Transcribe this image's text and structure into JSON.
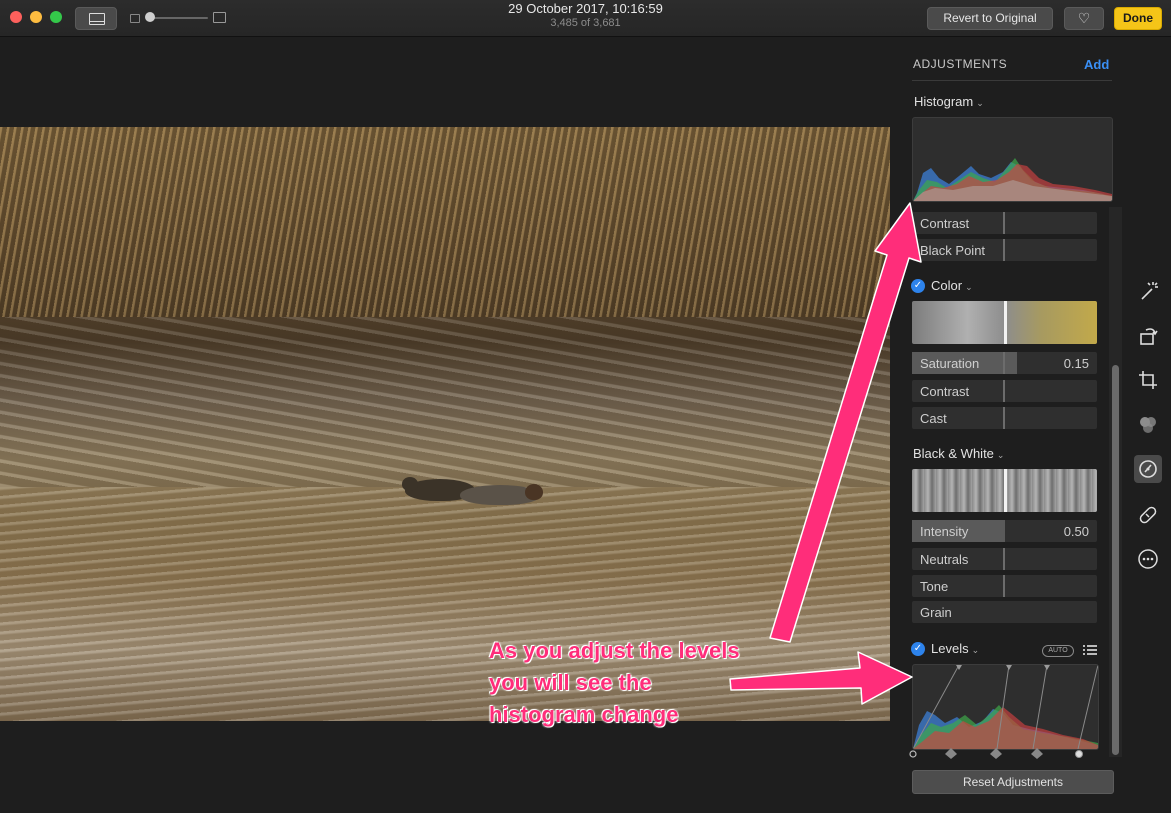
{
  "window": {
    "title": "29 October 2017, 10:16:59",
    "subtitle": "3,485 of 3,681"
  },
  "toolbar": {
    "revert_label": "Revert to Original",
    "favorite_icon": "heart-icon",
    "done_label": "Done"
  },
  "panel": {
    "title": "ADJUSTMENTS",
    "add_label": "Add",
    "histogram_label": "Histogram",
    "light_sliders": [
      "Contrast",
      "Black Point"
    ],
    "color": {
      "label": "Color",
      "enabled": true,
      "sliders": [
        {
          "label": "Saturation",
          "value": "0.15"
        },
        {
          "label": "Contrast",
          "value": ""
        },
        {
          "label": "Cast",
          "value": ""
        }
      ]
    },
    "bw": {
      "label": "Black & White",
      "sliders": [
        {
          "label": "Intensity",
          "value": "0.50"
        },
        {
          "label": "Neutrals",
          "value": ""
        },
        {
          "label": "Tone",
          "value": ""
        },
        {
          "label": "Grain",
          "value": ""
        }
      ]
    },
    "levels": {
      "label": "Levels",
      "enabled": true,
      "auto_label": "AUTO"
    },
    "reset_label": "Reset Adjustments"
  },
  "tools": [
    "magic-wand-icon",
    "rotate-icon",
    "crop-icon",
    "filters-icon",
    "adjust-icon",
    "retouch-icon",
    "more-icon"
  ],
  "annotation": {
    "lines": [
      "As you adjust the levels",
      "you will see the",
      "histogram change"
    ],
    "color": "#ff2d7a"
  },
  "colors": {
    "accent": "#2d83ec",
    "done": "#f5c518",
    "link": "#3a8ff5"
  }
}
